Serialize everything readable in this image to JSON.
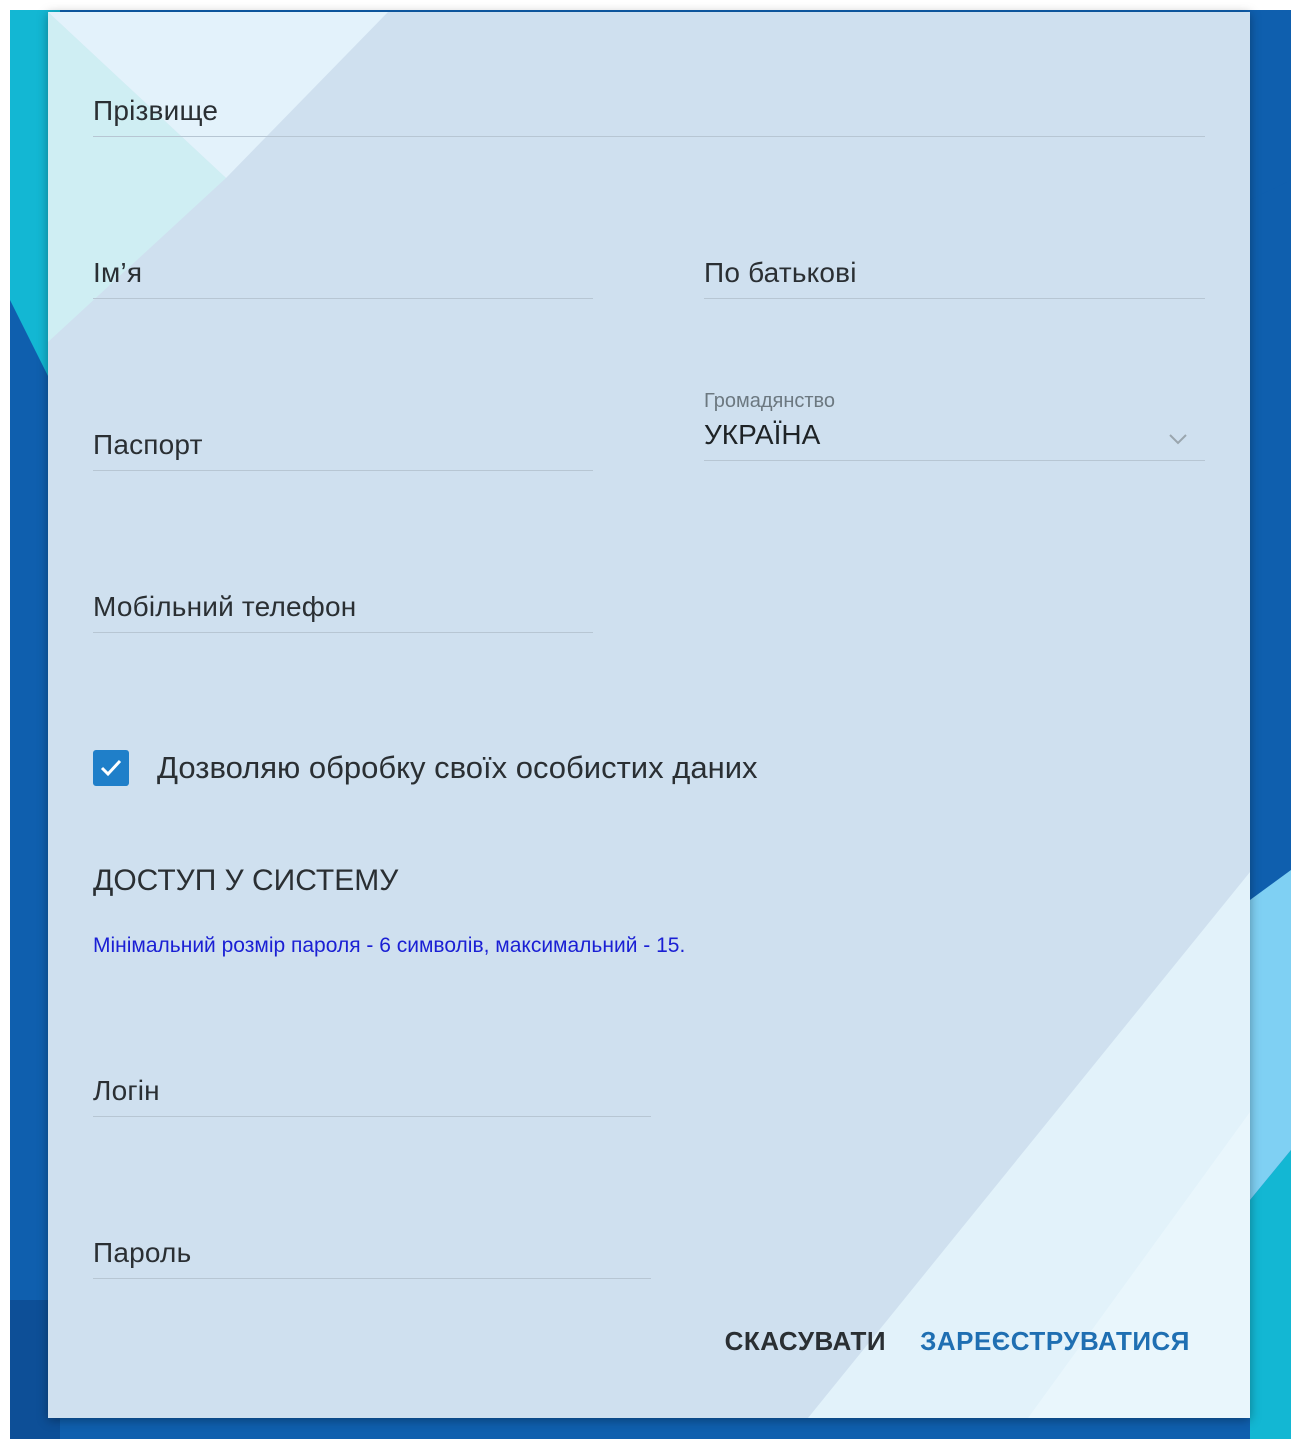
{
  "form": {
    "surname": {
      "placeholder": "Прізвище"
    },
    "first_name": {
      "placeholder": "Ім’я"
    },
    "patronymic": {
      "placeholder": "По батькові"
    },
    "passport": {
      "placeholder": "Паспорт"
    },
    "citizenship": {
      "label": "Громадянство",
      "value": "УКРАЇНА"
    },
    "mobile_phone": {
      "placeholder": "Мобільний телефон"
    },
    "consent": {
      "label": "Дозволяю обробку своїх особистих даних",
      "checked": true
    },
    "access_section": {
      "title": "ДОСТУП У СИСТЕМУ"
    },
    "password_hint": "Мінімальний розмір пароля - 6 символів, максимальний - 15.",
    "login": {
      "placeholder": "Логін"
    },
    "password": {
      "placeholder": "Пароль"
    }
  },
  "actions": {
    "cancel_label": "СКАСУВАТИ",
    "register_label": "ЗАРЕЄСТРУВАТИСЯ"
  },
  "colors": {
    "accent": "#1f7fc9",
    "hint_text": "#1a1fd4",
    "register_button": "#1f6fb2",
    "background_blue": "#0f5fae",
    "background_cyan": "#13b7d3"
  }
}
